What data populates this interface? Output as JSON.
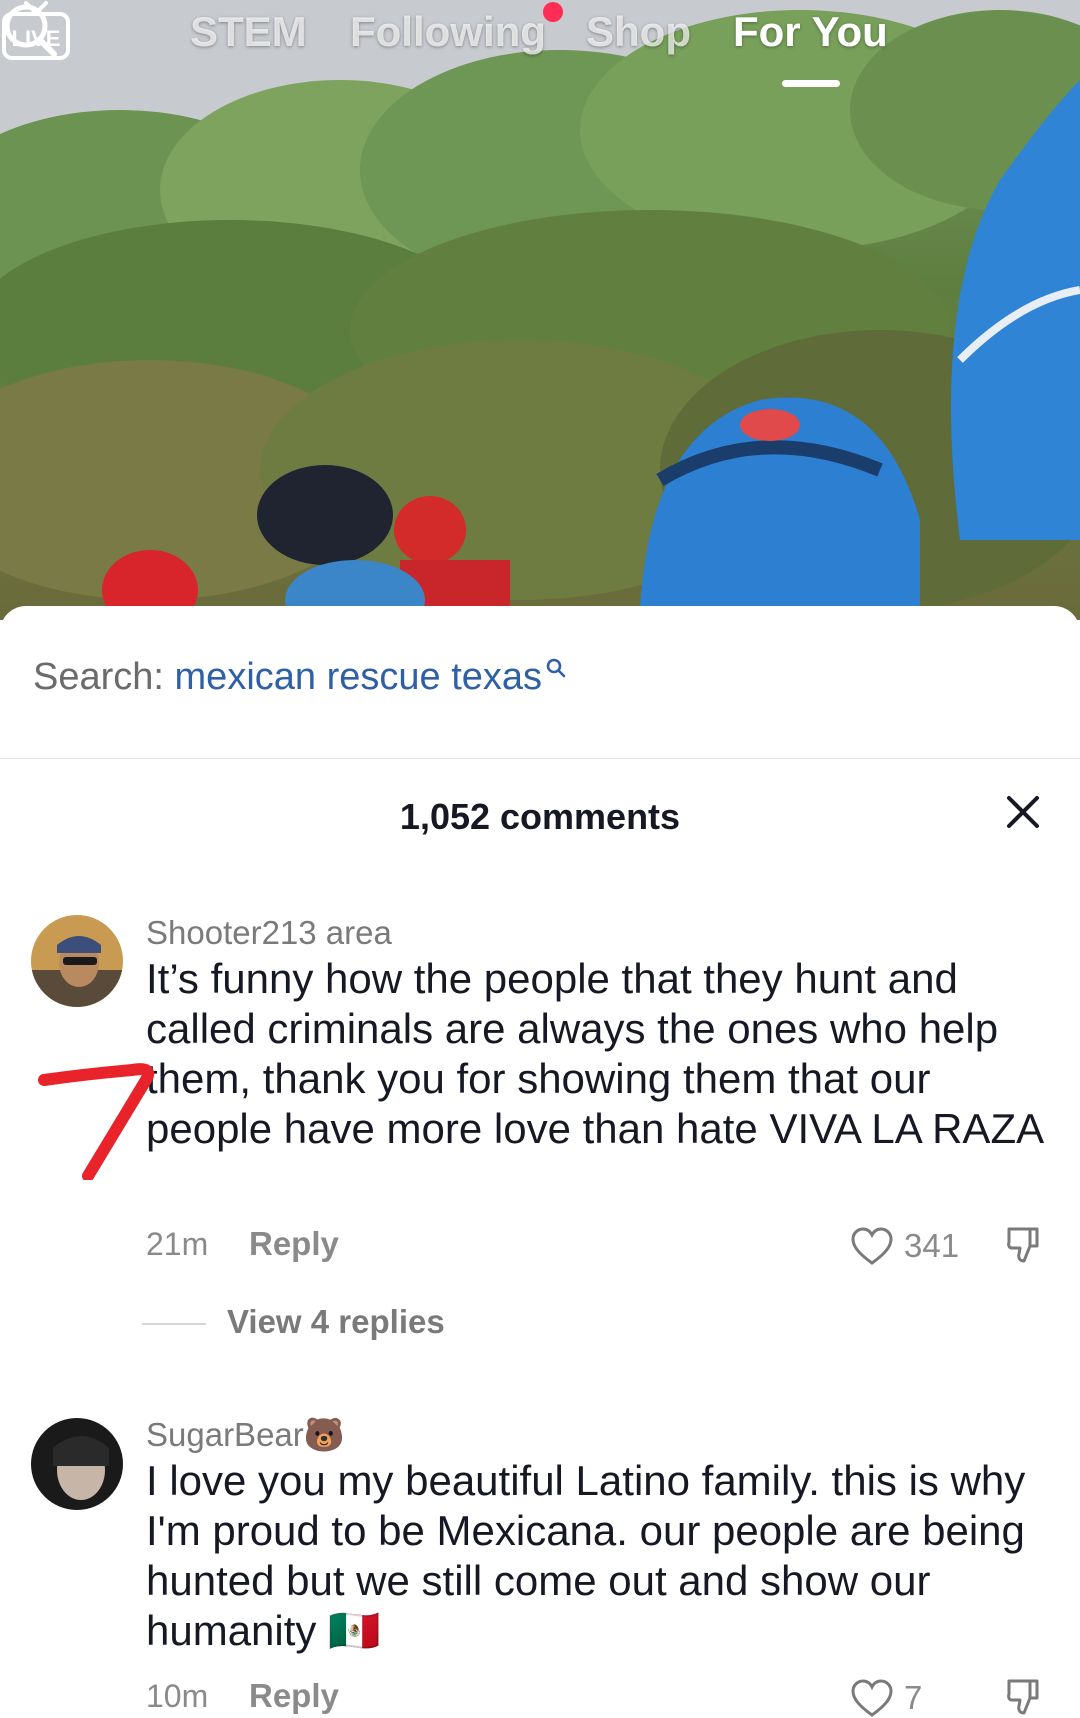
{
  "top_nav": {
    "live_label": "LIVE",
    "tabs": [
      "STEM",
      "Following",
      "Shop",
      "For You"
    ],
    "active_tab": "For You",
    "following_has_notification": true
  },
  "search_suggestion": {
    "prefix": "Search:",
    "query": "mexican rescue texas"
  },
  "comments_panel": {
    "title": "1,052 comments"
  },
  "comments": [
    {
      "username": "Shooter213 area",
      "text": "It’s funny how the people that they hunt and called criminals are always the ones who help them, thank you for showing them that our people have more love than hate VIVA LA RAZA",
      "time": "21m",
      "reply_label": "Reply",
      "likes": "341",
      "view_replies": "View 4 replies"
    },
    {
      "username": "SugarBear🐻",
      "text": "I love you my beautiful Latino family. this is why I'm proud to be Mexicana. our people are being hunted but we still come out and show our humanity 🇲🇽",
      "time": "10m",
      "reply_label": "Reply",
      "likes": "7"
    }
  ],
  "colors": {
    "search_query": "#2f5fa7",
    "notification_dot": "#ff2d55",
    "annotation": "#e8242a",
    "text_primary": "#161823",
    "text_secondary": "#8a8a8a"
  }
}
